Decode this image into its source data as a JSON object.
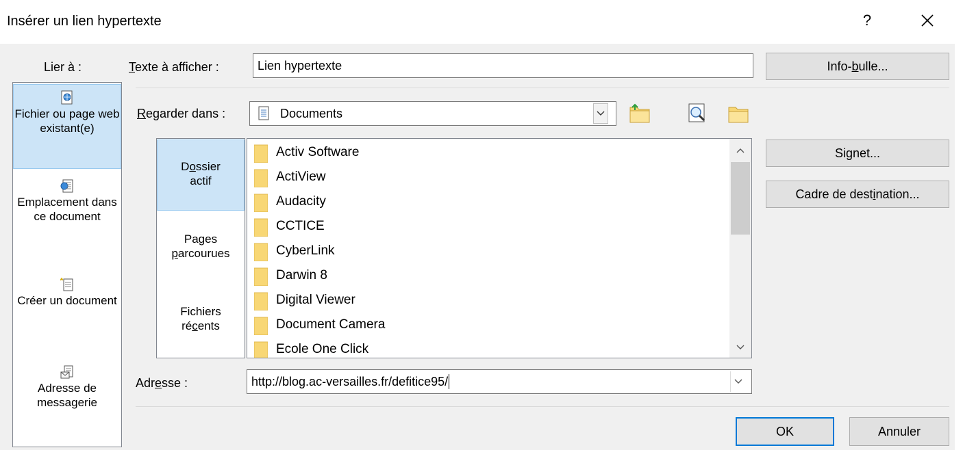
{
  "window": {
    "title": "Insérer un lien hypertexte",
    "help": "?",
    "close": "×"
  },
  "link_to": {
    "label": "Lier à :",
    "items": [
      {
        "label": "Fichier ou page web existant(e)",
        "icon": "web-page-icon",
        "selected": true
      },
      {
        "label": "Emplacement dans ce document",
        "icon": "document-place-icon",
        "selected": false
      },
      {
        "label": "Créer un document",
        "icon": "new-document-icon",
        "selected": false
      },
      {
        "label": "Adresse de messagerie",
        "icon": "email-icon",
        "selected": false
      }
    ]
  },
  "display_text": {
    "label": "Texte à afficher :",
    "value": "Lien hypertexte"
  },
  "tooltip_button": "Info-bulle...",
  "look_in": {
    "label": "Regarder dans :",
    "value": "Documents",
    "tools": [
      "folder-up-icon",
      "browse-web-icon",
      "browse-file-icon"
    ]
  },
  "bookmarks_pane": {
    "items": [
      {
        "label": "Dossier actif",
        "selected": true
      },
      {
        "label": "Pages parcourues",
        "selected": false
      },
      {
        "label": "Fichiers récents",
        "selected": false
      }
    ]
  },
  "files": [
    "Activ Software",
    "ActiView",
    "Audacity",
    "CCTICE",
    "CyberLink",
    "Darwin 8",
    "Digital Viewer",
    "Document Camera",
    "Ecole One Click"
  ],
  "side_buttons": {
    "bookmark": "Signet...",
    "target_frame": "Cadre de destination..."
  },
  "address": {
    "label": "Adresse :",
    "value": "http://blog.ac-versailles.fr/defitice95/"
  },
  "footer": {
    "ok": "OK",
    "cancel": "Annuler"
  },
  "colors": {
    "selection": "#cce4f7",
    "selection_border": "#99c9ef",
    "default_button_border": "#0078d7",
    "folder": "#f8d775"
  }
}
